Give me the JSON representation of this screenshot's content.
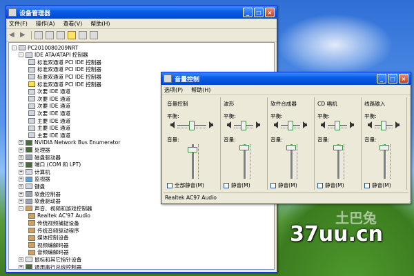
{
  "device_manager": {
    "title": "设备管理器",
    "menu": [
      "文件(F)",
      "操作(A)",
      "查看(V)",
      "帮助(H)"
    ],
    "tree": [
      {
        "text": "PC2010080209NRT",
        "level": 0,
        "exp": "-",
        "icon": "computer"
      },
      {
        "text": "IDE ATA/ATAPI 控制器",
        "level": 1,
        "exp": "-",
        "icon": "ide"
      },
      {
        "text": "标准双通道 PCI IDE 控制器",
        "level": 2,
        "icon": "ide"
      },
      {
        "text": "标准双通道 PCI IDE 控制器",
        "level": 2,
        "icon": "ide"
      },
      {
        "text": "标准双通道 PCI IDE 控制器",
        "level": 2,
        "icon": "ide"
      },
      {
        "text": "标准双通道 PCI IDE 控制器",
        "level": 2,
        "icon": "warning"
      },
      {
        "text": "次要 IDE 通道",
        "level": 2,
        "icon": "ide"
      },
      {
        "text": "次要 IDE 通道",
        "level": 2,
        "icon": "ide"
      },
      {
        "text": "次要 IDE 通道",
        "level": 2,
        "icon": "ide"
      },
      {
        "text": "次要 IDE 通道",
        "level": 2,
        "icon": "ide"
      },
      {
        "text": "主要 IDE 通道",
        "level": 2,
        "icon": "ide"
      },
      {
        "text": "主要 IDE 通道",
        "level": 2,
        "icon": "ide"
      },
      {
        "text": "主要 IDE 通道",
        "level": 2,
        "icon": "ide"
      },
      {
        "text": "NVIDIA Network Bus Enumerator",
        "level": 1,
        "exp": "+",
        "icon": "chip"
      },
      {
        "text": "处理器",
        "level": 1,
        "exp": "+",
        "icon": "chip"
      },
      {
        "text": "磁盘驱动器",
        "level": 1,
        "exp": "+",
        "icon": "disk"
      },
      {
        "text": "端口 (COM 和 LPT)",
        "level": 1,
        "exp": "+",
        "icon": "chip"
      },
      {
        "text": "计算机",
        "level": 1,
        "exp": "+",
        "icon": "computer"
      },
      {
        "text": "监视器",
        "level": 1,
        "exp": "+",
        "icon": "monitor"
      },
      {
        "text": "键盘",
        "level": 1,
        "exp": "+",
        "icon": "keyboard"
      },
      {
        "text": "软盘控制器",
        "level": 1,
        "exp": "+",
        "icon": "disk"
      },
      {
        "text": "软盘驱动器",
        "level": 1,
        "exp": "+",
        "icon": "disk"
      },
      {
        "text": "声音、视频和游戏控制器",
        "level": 1,
        "exp": "-",
        "icon": "sound"
      },
      {
        "text": "Realtek AC'97 Audio",
        "level": 2,
        "icon": "sound"
      },
      {
        "text": "传统视频捕捉设备",
        "level": 2,
        "icon": "sound"
      },
      {
        "text": "传统音频驱动程序",
        "level": 2,
        "icon": "sound"
      },
      {
        "text": "媒体控制设备",
        "level": 2,
        "icon": "sound"
      },
      {
        "text": "视频编解码器",
        "level": 2,
        "icon": "sound"
      },
      {
        "text": "音频编解码器",
        "level": 2,
        "icon": "sound"
      },
      {
        "text": "鼠标和其它指针设备",
        "level": 1,
        "exp": "+",
        "icon": "mouse"
      },
      {
        "text": "通用串行总线控制器",
        "level": 1,
        "exp": "+",
        "icon": "chip"
      }
    ]
  },
  "volume_control": {
    "title": "音量控制",
    "menu": [
      "选项(P)",
      "帮助(H)"
    ],
    "balance_label": "平衡:",
    "volume_label": "音量:",
    "columns": [
      {
        "title": "音量控制",
        "mute_label": "全部静音(M)",
        "balance": 0.5,
        "volume": 0.85
      },
      {
        "title": "波形",
        "mute_label": "静音(M)",
        "balance": 0.5,
        "volume": 0.9
      },
      {
        "title": "软件合成器",
        "mute_label": "静音(M)",
        "balance": 0.5,
        "volume": 0.9
      },
      {
        "title": "CD 唱机",
        "mute_label": "静音(M)",
        "balance": 0.5,
        "volume": 0.9
      },
      {
        "title": "线路输入",
        "mute_label": "静音(M)",
        "balance": 0.5,
        "volume": 0.9
      }
    ],
    "status": "Realtek AC97 Audio"
  },
  "watermark": {
    "text": "37uu.cn",
    "sub": "土巴兔"
  }
}
